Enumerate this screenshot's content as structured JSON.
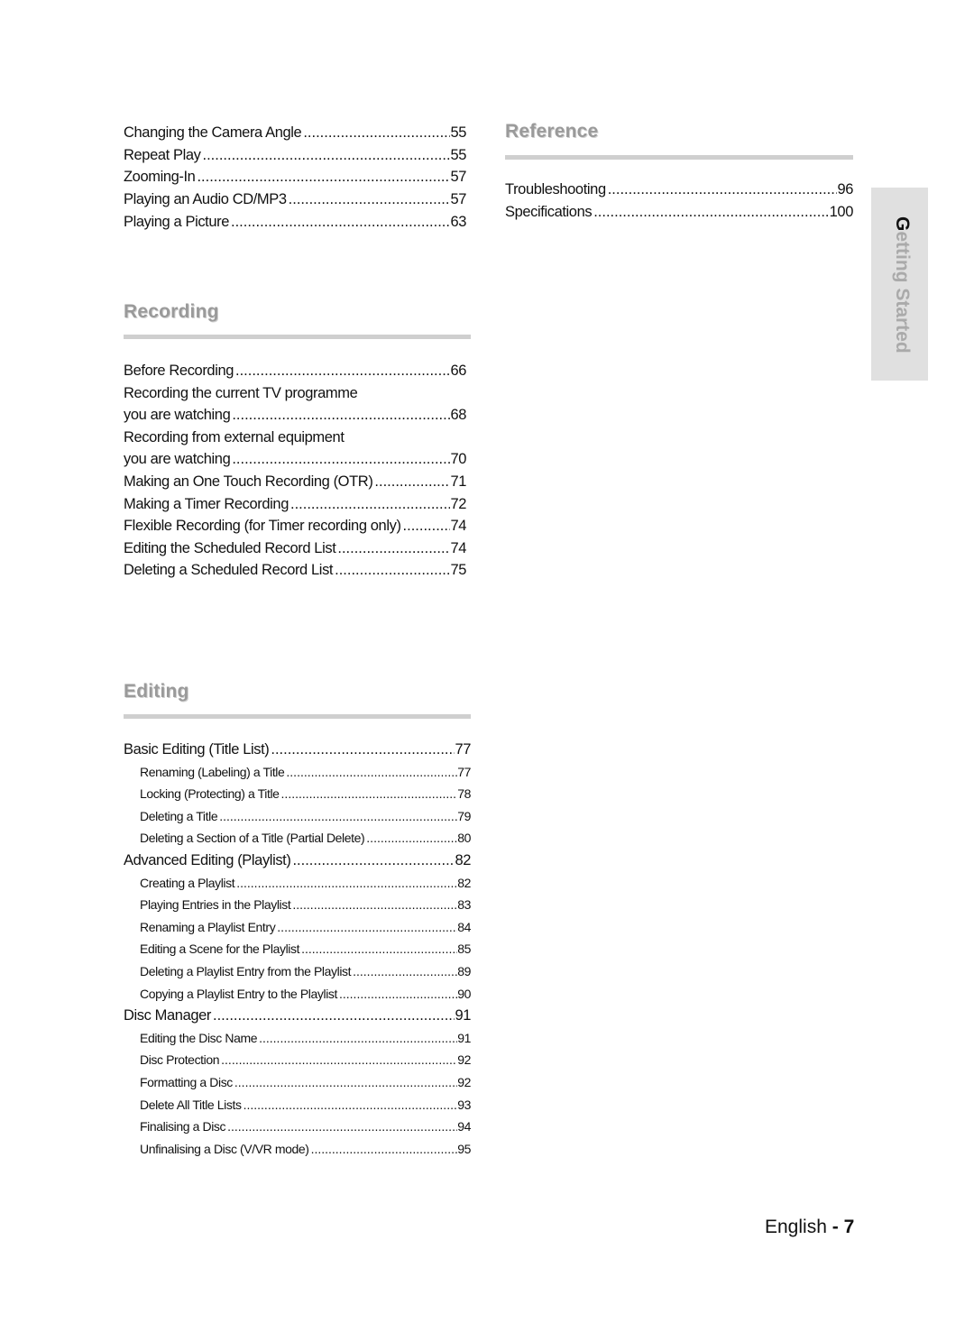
{
  "playback_continued": {
    "entries": [
      {
        "title": "Changing the Camera Angle",
        "page": "55"
      },
      {
        "title": "Repeat Play",
        "page": "55"
      },
      {
        "title": "Zooming-In",
        "page": "57"
      },
      {
        "title": "Playing an Audio CD/MP3",
        "page": "57"
      },
      {
        "title": "Playing a Picture",
        "page": "63"
      }
    ]
  },
  "recording": {
    "heading": "Recording",
    "entries": [
      {
        "title": "Before Recording",
        "page": "66"
      },
      {
        "title": "Recording the current TV programme",
        "page": ""
      },
      {
        "title": "you are watching",
        "page": "68"
      },
      {
        "title": "Recording from external equipment",
        "page": ""
      },
      {
        "title": "you are watching",
        "page": "70"
      },
      {
        "title": "Making an One Touch Recording (OTR)",
        "page": "71"
      },
      {
        "title": "Making a Timer Recording",
        "page": "72"
      },
      {
        "title": "Flexible Recording (for Timer recording only)",
        "page": "74"
      },
      {
        "title": "Editing the Scheduled Record List",
        "page": "74"
      },
      {
        "title": "Deleting a Scheduled Record List",
        "page": "75"
      }
    ]
  },
  "editing": {
    "heading": "Editing",
    "entries": [
      {
        "title": "Basic Editing (Title List)",
        "page": "77",
        "level": 1
      },
      {
        "title": "Renaming (Labeling) a Title",
        "page": "77",
        "level": 2
      },
      {
        "title": "Locking (Protecting) a Title",
        "page": "78",
        "level": 2
      },
      {
        "title": "Deleting a Title",
        "page": "79",
        "level": 2
      },
      {
        "title": "Deleting a Section of a Title (Partial Delete)",
        "page": "80",
        "level": 2
      },
      {
        "title": "Advanced Editing (Playlist)",
        "page": "82",
        "level": 1
      },
      {
        "title": "Creating a Playlist",
        "page": "82",
        "level": 2
      },
      {
        "title": "Playing Entries in the Playlist",
        "page": "83",
        "level": 2
      },
      {
        "title": "Renaming a Playlist Entry",
        "page": "84",
        "level": 2
      },
      {
        "title": "Editing a Scene for the Playlist",
        "page": "85",
        "level": 2
      },
      {
        "title": "Deleting a Playlist Entry from the Playlist",
        "page": "89",
        "level": 2
      },
      {
        "title": "Copying a Playlist Entry to the Playlist",
        "page": "90",
        "level": 2
      },
      {
        "title": "Disc Manager",
        "page": "91",
        "level": 1
      },
      {
        "title": "Editing the Disc Name",
        "page": "91",
        "level": 2
      },
      {
        "title": "Disc Protection",
        "page": "92",
        "level": 2
      },
      {
        "title": "Formatting a Disc",
        "page": "92",
        "level": 2
      },
      {
        "title": "Delete All Title Lists",
        "page": "93",
        "level": 2
      },
      {
        "title": "Finalising a Disc",
        "page": "94",
        "level": 2
      },
      {
        "title": "Unfinalising a Disc (V/VR mode)",
        "page": "95",
        "level": 2
      }
    ]
  },
  "reference": {
    "heading": "Reference",
    "entries": [
      {
        "title": "Troubleshooting",
        "page": "96"
      },
      {
        "title": "Specifications",
        "page": "100"
      }
    ]
  },
  "side_tab": {
    "first_letter": "G",
    "rest": "etting Started"
  },
  "footer": {
    "language": "English",
    "separator": " - ",
    "page_number": "7"
  }
}
